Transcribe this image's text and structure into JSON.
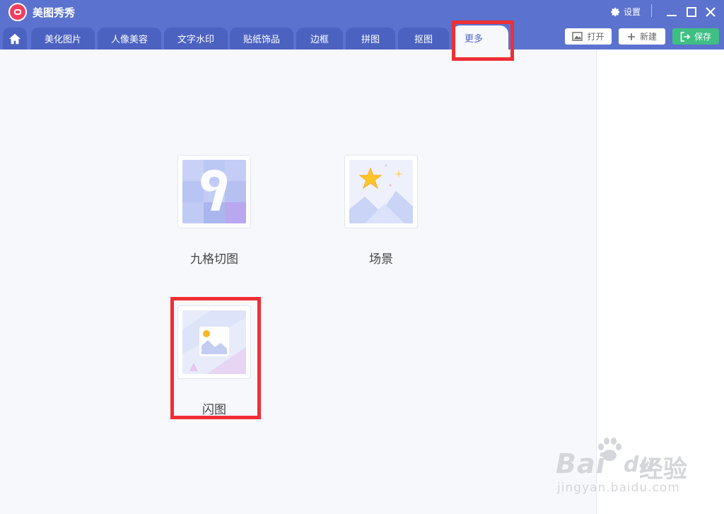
{
  "app": {
    "title": "美图秀秀",
    "settings_label": "设置"
  },
  "tabs": [
    {
      "label": "美化图片"
    },
    {
      "label": "人像美容"
    },
    {
      "label": "文字水印"
    },
    {
      "label": "贴纸饰品"
    },
    {
      "label": "边框"
    },
    {
      "label": "拼图"
    },
    {
      "label": "抠图"
    },
    {
      "label": "更多"
    }
  ],
  "actions": {
    "open": "打开",
    "new": "新建",
    "save": "保存"
  },
  "features": [
    {
      "label": "九格切图",
      "icon": "nine-grid-icon"
    },
    {
      "label": "场景",
      "icon": "scene-icon"
    },
    {
      "label": "闪图",
      "icon": "flash-image-icon"
    }
  ],
  "watermark": {
    "brand": "Bai",
    "brand2": "du",
    "cn": "经验",
    "url": "jingyan.baidu.com"
  },
  "colors": {
    "titlebar": "#5b72cf",
    "tab": "#4b62c1",
    "active_tab_text": "#4f67c9",
    "save": "#3fbf83",
    "highlight": "#ef2f34"
  }
}
